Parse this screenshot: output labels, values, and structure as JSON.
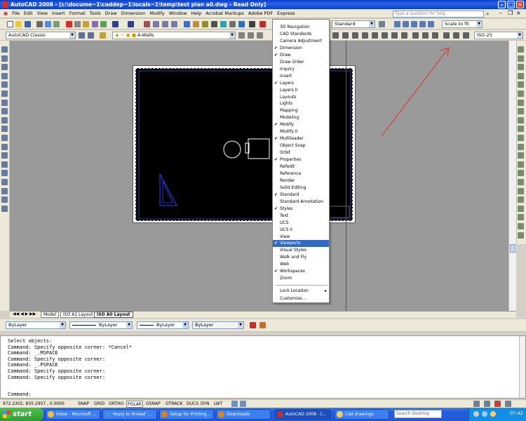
{
  "titlebar": {
    "title": "AutoCAD 2008 - [c:\\docume~1\\caddep~1\\locals~1\\temp\\test plan a0.dwg - Read Only]"
  },
  "menubar": {
    "items": [
      "File",
      "Edit",
      "View",
      "Insert",
      "Format",
      "Tools",
      "Draw",
      "Dimension",
      "Modify",
      "Window",
      "Help",
      "Acrobat Markups",
      "Adobe PDF",
      "Express"
    ]
  },
  "help": {
    "placeholder": "Type a question for help"
  },
  "toolbar": {
    "workspace": "AutoCAD Classic",
    "layer": "A-Walls",
    "text_style": "Standard",
    "scale": "Scale to fit",
    "dim_style": "ISO-25"
  },
  "properties": {
    "color": "ByLayer",
    "linetype": "ByLayer",
    "lineweight": "ByLayer",
    "plotstyle": "ByLayer"
  },
  "layout_tabs": [
    "Model",
    "ISO A1 Layout",
    "ISO A0 Layout"
  ],
  "context_menu": {
    "items": [
      {
        "label": "3D Navigation",
        "checked": false
      },
      {
        "label": "CAD Standards",
        "checked": false
      },
      {
        "label": "Camera Adjustment",
        "checked": false
      },
      {
        "label": "Dimension",
        "checked": true
      },
      {
        "label": "Draw",
        "checked": true
      },
      {
        "label": "Draw Order",
        "checked": false
      },
      {
        "label": "Inquiry",
        "checked": false
      },
      {
        "label": "Insert",
        "checked": false
      },
      {
        "label": "Layers",
        "checked": true
      },
      {
        "label": "Layers II",
        "checked": false
      },
      {
        "label": "Layouts",
        "checked": false
      },
      {
        "label": "Lights",
        "checked": false
      },
      {
        "label": "Mapping",
        "checked": false
      },
      {
        "label": "Modeling",
        "checked": false
      },
      {
        "label": "Modify",
        "checked": true
      },
      {
        "label": "Modify II",
        "checked": false
      },
      {
        "label": "Multileader",
        "checked": true
      },
      {
        "label": "Object Snap",
        "checked": false
      },
      {
        "label": "Orbit",
        "checked": false
      },
      {
        "label": "Properties",
        "checked": true
      },
      {
        "label": "Refedit",
        "checked": false
      },
      {
        "label": "Reference",
        "checked": false
      },
      {
        "label": "Render",
        "checked": false
      },
      {
        "label": "Solid Editing",
        "checked": false
      },
      {
        "label": "Standard",
        "checked": true
      },
      {
        "label": "Standard Annotation",
        "checked": false
      },
      {
        "label": "Styles",
        "checked": true
      },
      {
        "label": "Text",
        "checked": false
      },
      {
        "label": "UCS",
        "checked": false
      },
      {
        "label": "UCS II",
        "checked": false
      },
      {
        "label": "View",
        "checked": false
      },
      {
        "label": "Viewports",
        "checked": true,
        "highlighted": true
      },
      {
        "label": "Visual Styles",
        "checked": false
      },
      {
        "label": "Walk and Fly",
        "checked": false
      },
      {
        "label": "Web",
        "checked": false
      },
      {
        "label": "Workspaces",
        "checked": true
      },
      {
        "label": "Zoom",
        "checked": false
      }
    ],
    "lock_location": "Lock Location",
    "customize": "Customize..."
  },
  "command_lines": [
    "Select objects:",
    "Command: Specify opposite corner: *Cancel*",
    "Command: _.MSPACE",
    "Command: Specify opposite corner:",
    "Command: _.PSPACE",
    "Command: Specify opposite corner:",
    "Command: Specify opposite corner:"
  ],
  "command_prompt": "Command:",
  "status": {
    "coords": "972.2302, 835.2907 , 0.0000",
    "toggles": [
      "SNAP",
      "GRID",
      "ORTHO",
      "POLAR",
      "OSNAP",
      "OTRACK",
      "DUCS",
      "DYN",
      "LWT"
    ]
  },
  "taskbar": {
    "start": "start",
    "tasks": [
      "Inbox - Microsoft ...",
      "Reply to thread '...",
      "Setup for Printing...",
      "Downloads",
      "AutoCAD 2008 - [...",
      "Cad drawings"
    ],
    "search_placeholder": "Search Desktop",
    "clock": "07:42"
  },
  "colors": {
    "accent": "#316ac5",
    "arrow": "#e03030",
    "canvas": "#9a9a9a"
  }
}
